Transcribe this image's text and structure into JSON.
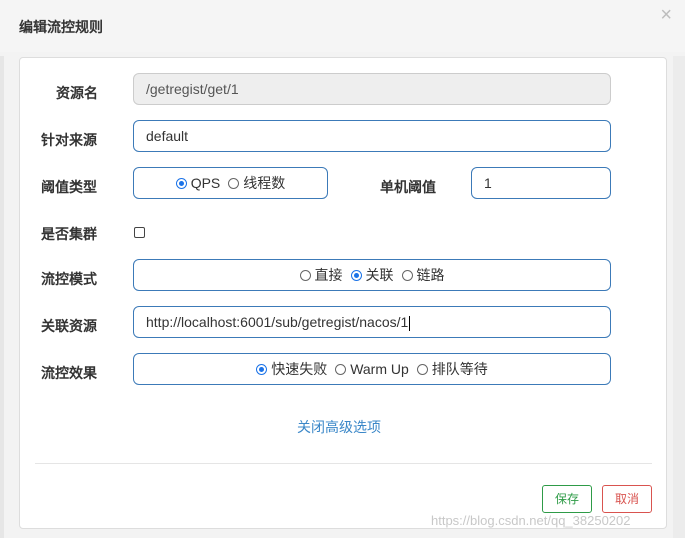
{
  "dialog": {
    "title": "编辑流控规则",
    "close_glyph": "×"
  },
  "form": {
    "resource_name": {
      "label": "资源名",
      "value": "/getregist/get/1"
    },
    "limit_app": {
      "label": "针对来源",
      "value": "default"
    },
    "threshold_type": {
      "label": "阈值类型",
      "options": [
        {
          "label": "QPS",
          "selected": true
        },
        {
          "label": "线程数",
          "selected": false
        }
      ]
    },
    "single_threshold": {
      "label": "单机阈值",
      "value": "1"
    },
    "cluster": {
      "label": "是否集群",
      "checked": false
    },
    "control_mode": {
      "label": "流控模式",
      "options": [
        {
          "label": "直接",
          "selected": false
        },
        {
          "label": "关联",
          "selected": true
        },
        {
          "label": "链路",
          "selected": false
        }
      ]
    },
    "related_resource": {
      "label": "关联资源",
      "value": "http://localhost:6001/sub/getregist/nacos/1"
    },
    "control_effect": {
      "label": "流控效果",
      "options": [
        {
          "label": "快速失败",
          "selected": true
        },
        {
          "label": "Warm Up",
          "selected": false
        },
        {
          "label": "排队等待",
          "selected": false
        }
      ]
    },
    "advanced_toggle": "关闭高级选项"
  },
  "footer": {
    "save_label": "保存",
    "cancel_label": "取消"
  },
  "watermark": "https://blog.csdn.net/qq_38250202",
  "colors": {
    "field_border": "#3c7ab8",
    "radio_selected": "#1b73e8",
    "save": "#2e9b47",
    "cancel": "#d9534f",
    "link": "#3a87c8"
  }
}
